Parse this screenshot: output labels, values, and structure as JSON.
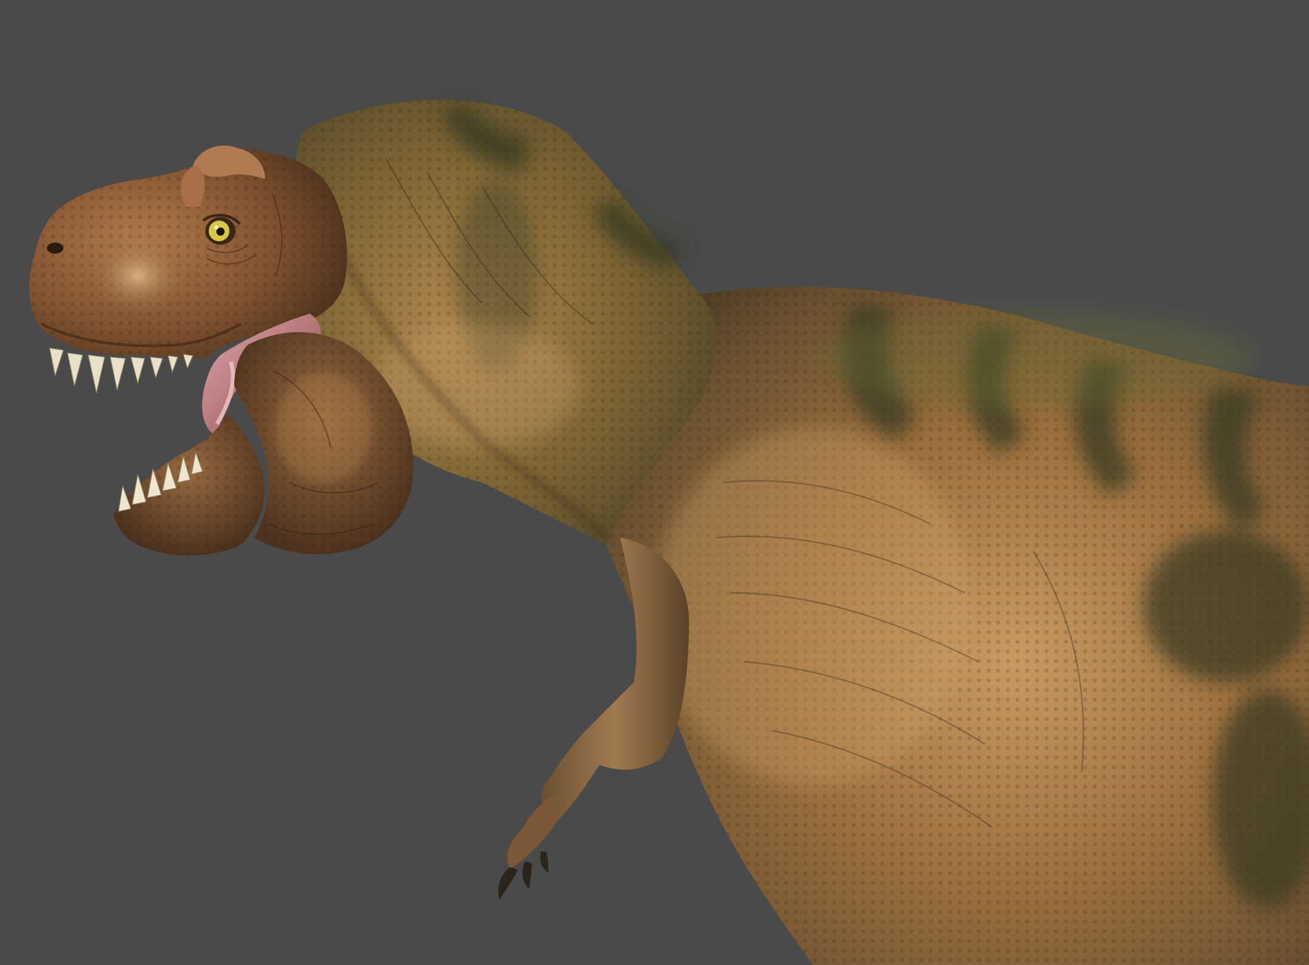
{
  "scene": {
    "subject": "tyrannosaurus-rex",
    "colors": {
      "background": "#4a4a4b",
      "skin_highlight": "#c99a62",
      "skin_mid": "#8a6236",
      "skin_shadow": "#3e3320",
      "stripe": "#343a22",
      "moss": "#6b6e35",
      "mouth": "#c98a8e",
      "teeth": "#e9e0c8",
      "eye": "#d7c84a",
      "claw": "#2a241c"
    }
  }
}
